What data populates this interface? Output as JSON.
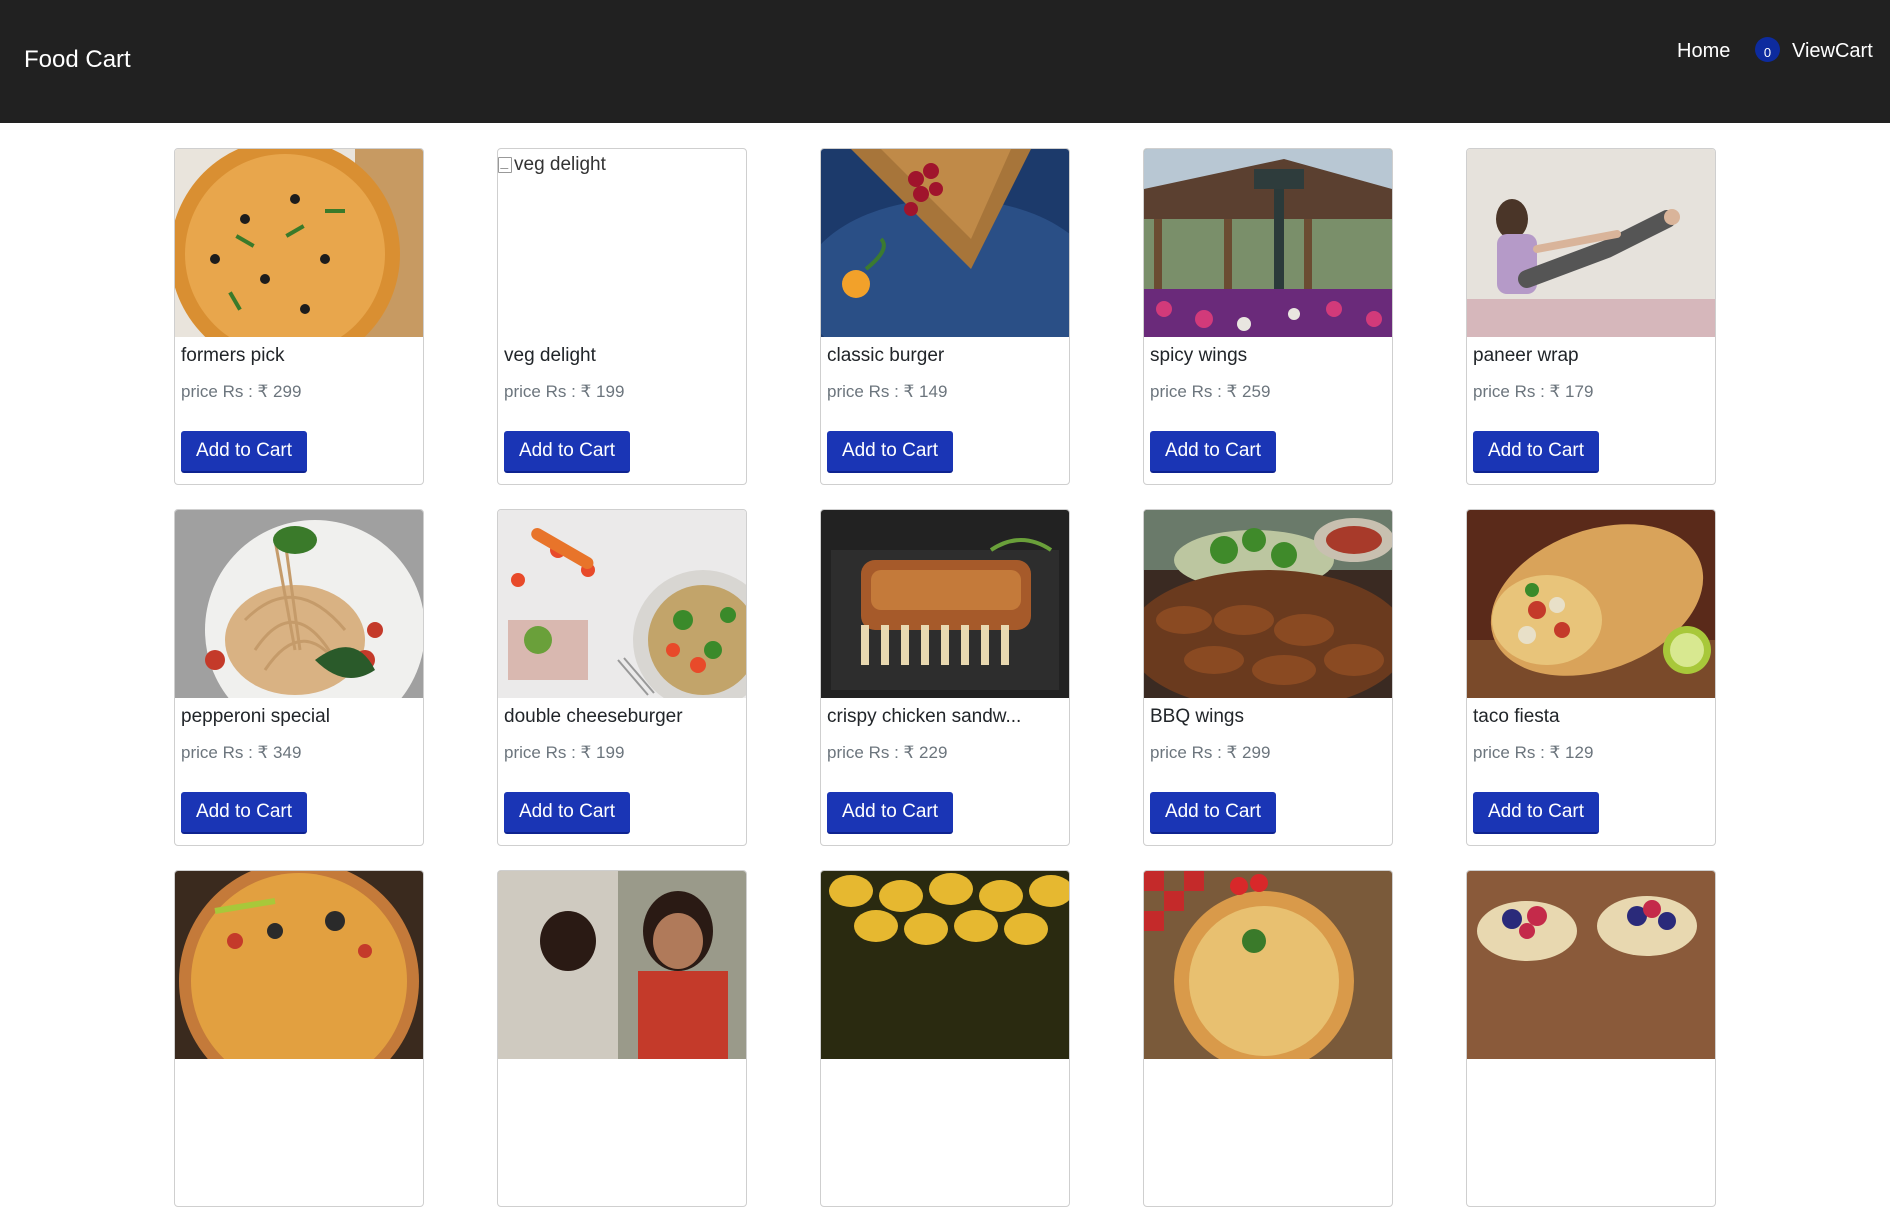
{
  "navbar": {
    "brand": "Food Cart",
    "home_label": "Home",
    "cart_count": "0",
    "cart_label": "ViewCart"
  },
  "products": [
    {
      "name": "formers pick",
      "price": "price Rs : ₹ 299",
      "button": "Add to Cart",
      "image": "pizza"
    },
    {
      "name": "veg delight",
      "price": "price Rs : ₹ 199",
      "button": "Add to Cart",
      "image": "broken",
      "alt": "veg delight"
    },
    {
      "name": "classic burger",
      "price": "price Rs : ₹ 149",
      "button": "Add to Cart",
      "image": "cake"
    },
    {
      "name": "spicy wings",
      "price": "price Rs : ₹ 259",
      "button": "Add to Cart",
      "image": "gazebo"
    },
    {
      "name": "paneer wrap",
      "price": "price Rs : ₹ 179",
      "button": "Add to Cart",
      "image": "yoga"
    },
    {
      "name": "pepperoni special",
      "price": "price Rs : ₹ 349",
      "button": "Add to Cart",
      "image": "pasta"
    },
    {
      "name": "double cheeseburger",
      "price": "price Rs : ₹ 199",
      "button": "Add to Cart",
      "image": "salad"
    },
    {
      "name": "crispy chicken sandw...",
      "price": "price Rs : ₹ 229",
      "button": "Add to Cart",
      "image": "ribs"
    },
    {
      "name": "BBQ wings",
      "price": "price Rs : ₹ 299",
      "button": "Add to Cart",
      "image": "bbq"
    },
    {
      "name": "taco fiesta",
      "price": "price Rs : ₹ 129",
      "button": "Add to Cart",
      "image": "burrito"
    },
    {
      "name": "",
      "price": "",
      "button": "",
      "image": "pizza2"
    },
    {
      "name": "",
      "price": "",
      "button": "",
      "image": "girl"
    },
    {
      "name": "",
      "price": "",
      "button": "",
      "image": "potato"
    },
    {
      "name": "",
      "price": "",
      "button": "",
      "image": "pizza3"
    },
    {
      "name": "",
      "price": "",
      "button": "",
      "image": "tarts"
    }
  ],
  "colors": {
    "navbar_bg": "#212121",
    "button_bg": "#1a35b5",
    "badge_bg": "#0d2b9e"
  }
}
